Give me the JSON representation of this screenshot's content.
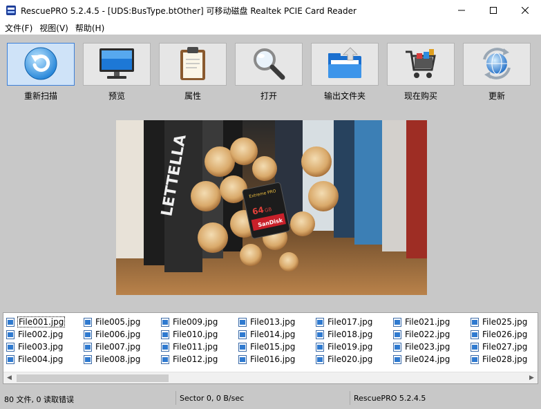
{
  "window": {
    "title": "RescuePRO 5.2.4.5 - [UDS:BusType.btOther] 可移动磁盘 Realtek PCIE Card Reader",
    "controls": [
      "minimize",
      "maximize",
      "close"
    ]
  },
  "menu": {
    "items": [
      {
        "label": "文件(F)"
      },
      {
        "label": "视图(V)"
      },
      {
        "label": "帮助(H)"
      }
    ]
  },
  "toolbar": {
    "buttons": [
      {
        "label": "重新扫描",
        "icon": "rescan-icon",
        "active": true
      },
      {
        "label": "预览",
        "icon": "monitor-icon"
      },
      {
        "label": "属性",
        "icon": "clipboard-icon"
      },
      {
        "label": "打开",
        "icon": "magnifier-icon"
      },
      {
        "label": "输出文件夹",
        "icon": "output-folder-icon"
      },
      {
        "label": "现在购买",
        "icon": "shopping-cart-icon"
      },
      {
        "label": "更新",
        "icon": "update-globe-icon"
      }
    ]
  },
  "preview": {
    "card_brand": "SanDisk",
    "card_line": "Extreme PRO",
    "card_capacity": "64",
    "card_unit": "GB",
    "book_text": "LETTELLA"
  },
  "files": {
    "selected": "File001.jpg",
    "columns": [
      [
        "File001.jpg",
        "File002.jpg",
        "File003.jpg",
        "File004.jpg"
      ],
      [
        "File005.jpg",
        "File006.jpg",
        "File007.jpg",
        "File008.jpg"
      ],
      [
        "File009.jpg",
        "File010.jpg",
        "File011.jpg",
        "File012.jpg"
      ],
      [
        "File013.jpg",
        "File014.jpg",
        "File015.jpg",
        "File016.jpg"
      ],
      [
        "File017.jpg",
        "File018.jpg",
        "File019.jpg",
        "File020.jpg"
      ],
      [
        "File021.jpg",
        "File022.jpg",
        "File023.jpg",
        "File024.jpg"
      ],
      [
        "File025.jpg",
        "File026.jpg",
        "File027.jpg",
        "File028.jpg"
      ]
    ]
  },
  "status": {
    "files": "80 文件, 0 读取错误",
    "sector": "Sector 0, 0 B/sec",
    "version": "RescuePRO 5.2.4.5"
  },
  "colors": {
    "window_bg": "#c8c8c8",
    "active_button_border": "#3c7fd8",
    "active_button_bg": "#cfe3f8"
  }
}
